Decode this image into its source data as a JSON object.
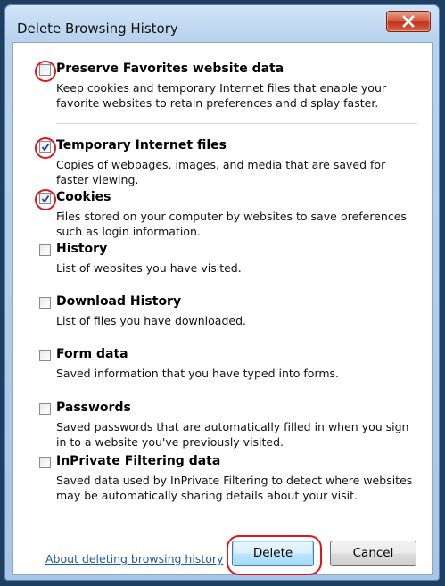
{
  "dialog": {
    "title": "Delete Browsing History",
    "close_glyph": "close-x-icon"
  },
  "options": [
    {
      "label": "Preserve Favorites website data",
      "description": "Keep cookies and temporary Internet files that enable your favorite websites to retain preferences and display faster.",
      "checked": false
    },
    {
      "label": "Temporary Internet files",
      "description": "Copies of webpages, images, and media that are saved for faster viewing.",
      "checked": true
    },
    {
      "label": "Cookies",
      "description": "Files stored on your computer by websites to save preferences such as login information.",
      "checked": true
    },
    {
      "label": "History",
      "description": "List of websites you have visited.",
      "checked": false
    },
    {
      "label": "Download History",
      "description": "List of files you have downloaded.",
      "checked": false
    },
    {
      "label": "Form data",
      "description": "Saved information that you have typed into forms.",
      "checked": false
    },
    {
      "label": "Passwords",
      "description": "Saved passwords that are automatically filled in when you sign in to a website you've previously visited.",
      "checked": false
    },
    {
      "label": "InPrivate Filtering data",
      "description": "Saved data used by InPrivate Filtering to detect where websites may be automatically sharing details about your visit.",
      "checked": false
    }
  ],
  "footer": {
    "about_link": "About deleting browsing history",
    "delete_label": "Delete",
    "cancel_label": "Cancel"
  },
  "colors": {
    "highlight_circle": "#e0161f",
    "link": "#1a5bb3",
    "close_button": "#c0341c"
  }
}
